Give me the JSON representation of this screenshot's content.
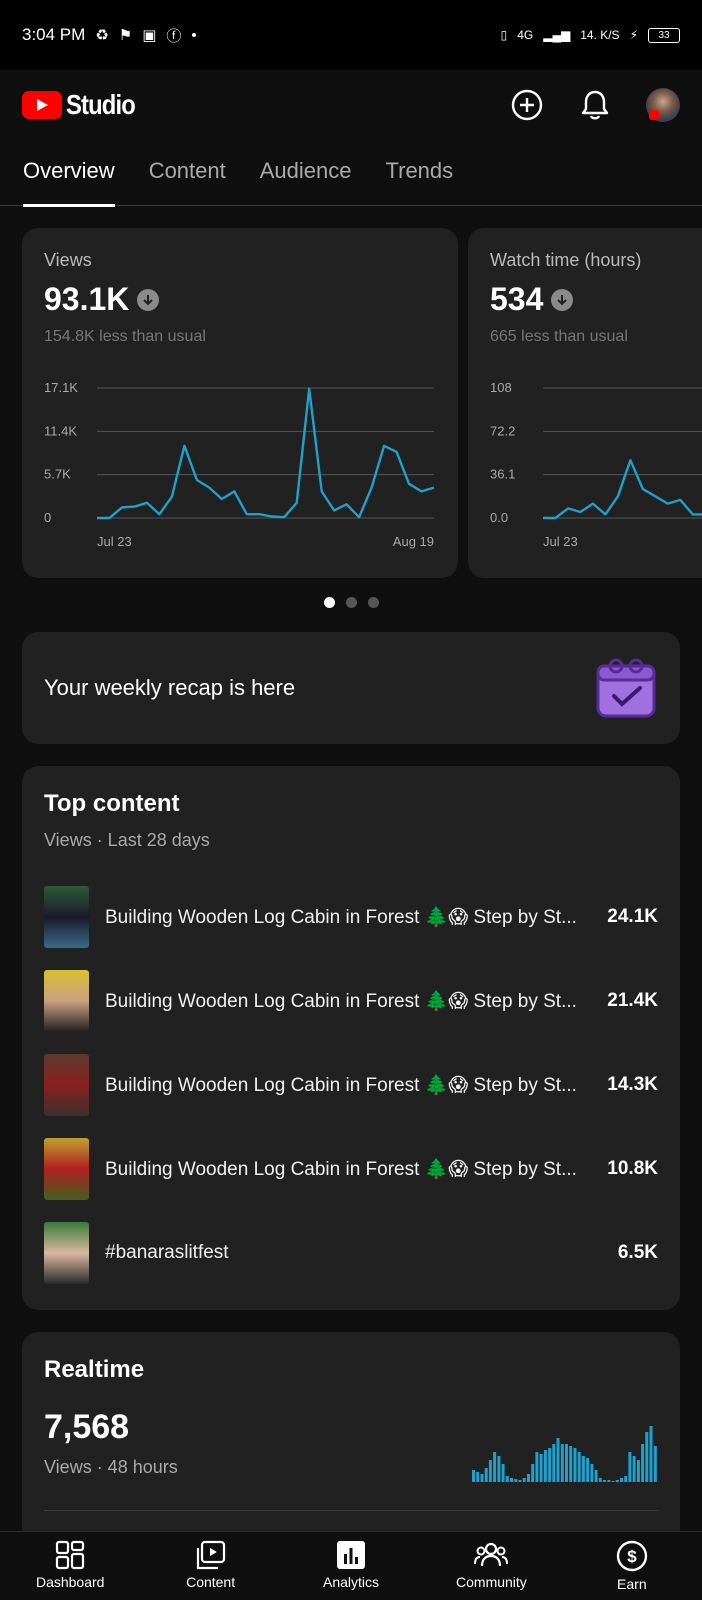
{
  "status_bar": {
    "time": "3:04 PM",
    "network": "4G",
    "speed": "14. K/S",
    "battery": "33"
  },
  "header": {
    "app_name": "Studio",
    "icons": [
      "create-icon",
      "bell-icon",
      "avatar"
    ]
  },
  "tabs": [
    {
      "label": "Overview",
      "active": true
    },
    {
      "label": "Content",
      "active": false
    },
    {
      "label": "Audience",
      "active": false
    },
    {
      "label": "Trends",
      "active": false
    }
  ],
  "metrics": [
    {
      "label": "Views",
      "value": "93.1K",
      "change": "154.8K less than usual",
      "y_ticks": [
        "17.1K",
        "11.4K",
        "5.7K",
        "0"
      ],
      "x_start": "Jul 23",
      "x_end": "Aug 19"
    },
    {
      "label": "Watch time (hours)",
      "value": "534",
      "change": "665 less than usual",
      "y_ticks": [
        "108",
        "72.2",
        "36.1",
        "0.0"
      ],
      "x_start": "Jul 23",
      "x_end": ""
    }
  ],
  "chart_data": [
    {
      "type": "line",
      "title": "Views",
      "ylim": [
        0,
        17100
      ],
      "x_labels": [
        "Jul 23",
        "Aug 19"
      ],
      "values": [
        0,
        0,
        1400,
        1500,
        2000,
        500,
        2800,
        9500,
        5000,
        4000,
        2500,
        3500,
        500,
        500,
        200,
        100,
        2000,
        17000,
        3500,
        1000,
        1800,
        100,
        4000,
        9500,
        8700,
        4500,
        3500,
        4000
      ],
      "color": "#1ea1cc"
    },
    {
      "type": "line",
      "title": "Watch time (hours)",
      "ylim": [
        0,
        108
      ],
      "x_labels": [
        "Jul 23"
      ],
      "values": [
        0,
        0,
        8,
        5,
        12,
        3,
        18,
        48,
        24,
        18,
        12,
        15,
        3,
        3
      ],
      "color": "#1ea1cc"
    }
  ],
  "carousel": {
    "count": 3,
    "active": 0
  },
  "recap": {
    "text": "Your weekly recap is here"
  },
  "top_content": {
    "title": "Top content",
    "subtitle": "Views · Last 28 days",
    "items": [
      {
        "title": "Building Wooden Log Cabin in Forest 🌲😱 Step by St...",
        "views": "24.1K",
        "thumb": [
          "#2d5a3a",
          "#1a1a2a",
          "#3a6a8a"
        ]
      },
      {
        "title": "Building Wooden Log Cabin in Forest 🌲😱 Step by St...",
        "views": "21.4K",
        "thumb": [
          "#d8c030",
          "#c8a080",
          "#202020"
        ]
      },
      {
        "title": "Building Wooden Log Cabin in Forest 🌲😱 Step by St...",
        "views": "14.3K",
        "thumb": [
          "#5a3a30",
          "#8a2020",
          "#3a3030"
        ]
      },
      {
        "title": "Building Wooden Log Cabin in Forest 🌲😱 Step by St...",
        "views": "10.8K",
        "thumb": [
          "#c0a030",
          "#b02020",
          "#406020"
        ]
      },
      {
        "title": "#banaraslitfest",
        "views": "6.5K",
        "thumb": [
          "#3a7a3a",
          "#d8b8a0",
          "#2a2a2a"
        ]
      }
    ]
  },
  "realtime": {
    "title": "Realtime",
    "value": "7,568",
    "subtitle": "Views · 48 hours",
    "bars": [
      12,
      10,
      8,
      14,
      22,
      30,
      26,
      18,
      6,
      4,
      3,
      2,
      4,
      8,
      18,
      30,
      28,
      32,
      34,
      38,
      44,
      38,
      38,
      36,
      34,
      30,
      26,
      24,
      18,
      12,
      4,
      2,
      2,
      1,
      2,
      4,
      6,
      30,
      26,
      22,
      38,
      50,
      56,
      36
    ]
  },
  "bottom_nav": [
    {
      "label": "Dashboard",
      "icon": "dashboard-icon",
      "active": false
    },
    {
      "label": "Content",
      "icon": "content-icon",
      "active": false
    },
    {
      "label": "Analytics",
      "icon": "analytics-icon",
      "active": true
    },
    {
      "label": "Community",
      "icon": "community-icon",
      "active": false
    },
    {
      "label": "Earn",
      "icon": "earn-icon",
      "active": false
    }
  ]
}
